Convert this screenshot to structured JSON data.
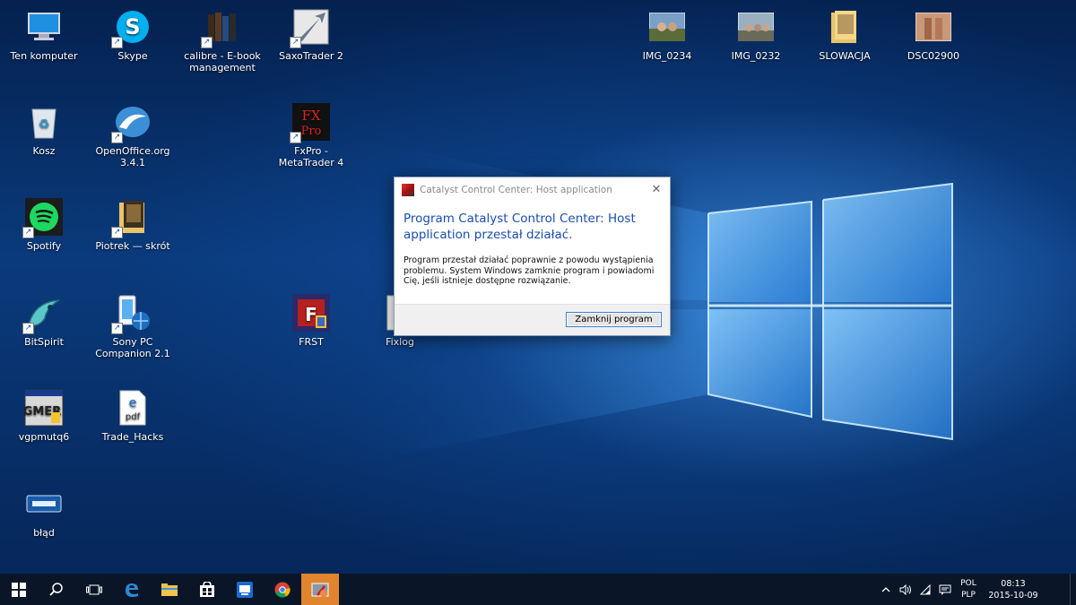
{
  "desktop": {
    "icons": [
      {
        "label": "Ten komputer"
      },
      {
        "label": "Skype"
      },
      {
        "label": "calibre - E-book management"
      },
      {
        "label": "SaxoTrader 2"
      },
      {
        "label": "IMG_0234"
      },
      {
        "label": "IMG_0232"
      },
      {
        "label": "SLOWACJA"
      },
      {
        "label": "DSC02900"
      },
      {
        "label": "Kosz"
      },
      {
        "label": "OpenOffice.org 3.4.1"
      },
      {
        "label": "FxPro - MetaTrader 4"
      },
      {
        "label": "Spotify"
      },
      {
        "label": "Piotrek — skrót"
      },
      {
        "label": "BitSpirit"
      },
      {
        "label": "Sony PC Companion 2.1"
      },
      {
        "label": "FRST"
      },
      {
        "label": "Fixlog"
      },
      {
        "label": "vgpmutq6"
      },
      {
        "label": "Trade_Hacks"
      },
      {
        "label": "błąd"
      }
    ]
  },
  "dialog": {
    "title": "Catalyst Control Center: Host application",
    "close_glyph": "✕",
    "heading": "Program Catalyst Control Center: Host application przestał działać.",
    "body": "Program przestał działać poprawnie z powodu wystąpienia problemu. System Windows zamknie program i powiadomi Cię, jeśli istnieje dostępne rozwiązanie.",
    "button": "Zamknij program"
  },
  "taskbar": {
    "apps": [
      "start-icon",
      "search-icon",
      "task-view-icon",
      "edge-icon",
      "file-explorer-icon",
      "store-icon",
      "teamviewer-icon",
      "chrome-icon",
      "catalyst-icon"
    ],
    "tray": {
      "lang_top": "POL",
      "lang_bottom": "PLP",
      "time": "08:13",
      "date": "2015-10-09"
    }
  },
  "colors": {
    "accent": "#1a4cb3",
    "taskbar_bg": "#0a1627",
    "active_app": "#e1842e"
  }
}
